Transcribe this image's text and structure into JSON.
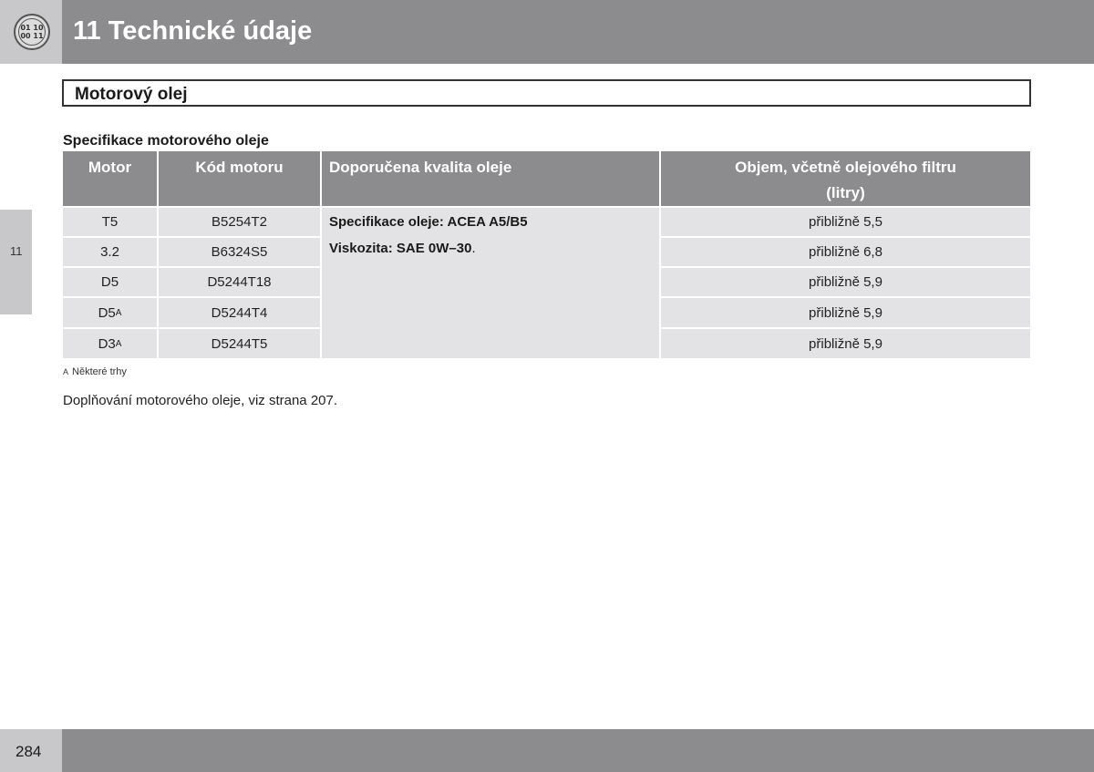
{
  "header": {
    "icon_line1": "01 10",
    "icon_line2": "00 11",
    "title": "11 Technické údaje"
  },
  "side_tab": "11",
  "section": {
    "title": "Motorový olej"
  },
  "table": {
    "caption": "Specifikace motorového oleje",
    "headers": {
      "motor": "Motor",
      "code": "Kód motoru",
      "quality": "Doporučena kvalita oleje",
      "volume_line1": "Objem, včetně olejového filtru",
      "volume_line2": "(litry)"
    },
    "rows": [
      {
        "motor": "T5",
        "motor_sup": "",
        "code": "B5254T2",
        "volume": "přibližně 5,5"
      },
      {
        "motor": "3.2",
        "motor_sup": "",
        "code": "B6324S5",
        "volume": "přibližně 6,8"
      },
      {
        "motor": "D5",
        "motor_sup": "",
        "code": "D5244T18",
        "volume": "přibližně 5,9"
      },
      {
        "motor": "D5",
        "motor_sup": "A",
        "code": "D5244T4",
        "volume": "přibližně 5,9"
      },
      {
        "motor": "D3",
        "motor_sup": "A",
        "code": "D5244T5",
        "volume": "přibližně 5,9"
      }
    ],
    "spec_line1": "Specifikace oleje: ACEA A5/B5",
    "spec_line2": "Viskozita: SAE 0W–30",
    "spec_line2_suffix": "."
  },
  "footnote": {
    "mark": "A",
    "text": "Některé trhy"
  },
  "reference": "Doplňování motorového oleje, viz strana 207.",
  "footer": {
    "page_number": "284"
  }
}
